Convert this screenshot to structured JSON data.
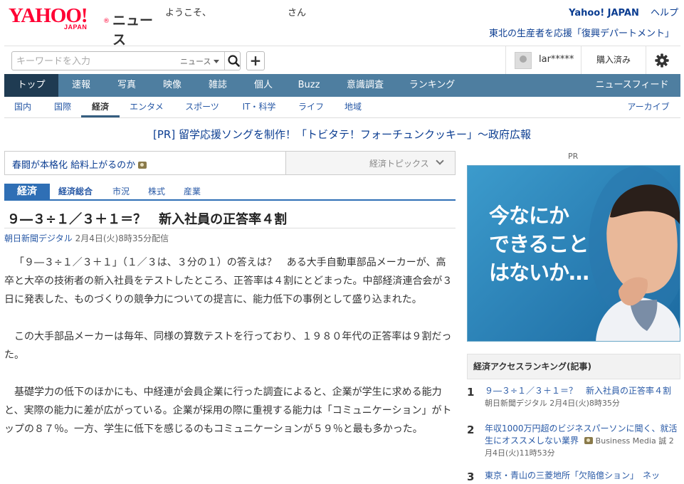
{
  "header": {
    "logo_yahoo": "YAHOO!",
    "logo_japan": "JAPAN",
    "logo_reg": "®",
    "logo_news": "ニュース",
    "welcome": "ようこそ、",
    "welcome_suffix": "さん",
    "yahoo_japan": "Yahoo! JAPAN",
    "help": "ヘルプ",
    "banner_link": "東北の生産者を応援「復興デパートメント」"
  },
  "toolbar": {
    "search_placeholder": "キーワードを入力",
    "search_scope": "ニュース",
    "plus": "+",
    "username": "lar*****",
    "purchased": "購入済み"
  },
  "nav": {
    "items": [
      "トップ",
      "速報",
      "写真",
      "映像",
      "雑誌",
      "個人",
      "Buzz",
      "意識調査",
      "ランキング"
    ],
    "feed": "ニュースフィード"
  },
  "subnav": {
    "items": [
      "国内",
      "国際",
      "経済",
      "エンタメ",
      "スポーツ",
      "IT・科学",
      "ライフ",
      "地域"
    ],
    "archive": "アーカイブ"
  },
  "pr_banner": "[PR] 留学応援ソングを制作！「トビタテ！フォーチュンクッキー」～政府広報",
  "topic": {
    "link": "春闘が本格化 給料上がるのか",
    "label": "経済トピックス"
  },
  "category_tabs": [
    "経済",
    "経済総合",
    "市況",
    "株式",
    "産業"
  ],
  "article": {
    "headline": "９―３÷１／３＋１＝？　新入社員の正答率４割",
    "source": "朝日新聞デジタル",
    "date": " 2月4日(火)8時35分配信",
    "paragraphs": [
      "「９―３÷１／３＋１」（１／３は、３分の１）の答えは？　ある大手自動車部品メーカーが、高卒と大卒の技術者の新入社員をテストしたところ、正答率は４割にとどまった。中部経済連合会が３日に発表した、ものづくりの競争力についての提言に、能力低下の事例として盛り込まれた。",
      "この大手部品メーカーは毎年、同様の算数テストを行っており、１９８０年代の正答率は９割だった。",
      "基礎学力の低下のほかにも、中経連が会員企業に行った調査によると、企業が学生に求める能力と、実際の能力に差が広がっている。企業が採用の際に重視する能力は「コミュニケーション」がトップの８７％。一方、学生に低下を感じるのもコミュニケーションが５９％と最も多かった。"
    ]
  },
  "sidebar": {
    "pr_label": "PR",
    "ad_lines": [
      "今なにか",
      "できること",
      "はないか…"
    ],
    "ranking_title": "経済アクセスランキング(記事)",
    "ranking": [
      {
        "num": "1",
        "title": "９―３÷１／３＋１＝？　新入社員の正答率４割",
        "source": "朝日新聞デジタル",
        "date": "2月4日(火)8時35分"
      },
      {
        "num": "2",
        "title": "年収1000万円超のビジネスパーソンに聞く、就活生にオススメしない業界",
        "source": "Business Media 誠",
        "date": "2月4日(火)11時53分"
      },
      {
        "num": "3",
        "title": "東京・青山の三菱地所「欠陥億ション」　ネッ",
        "source": "",
        "date": ""
      }
    ]
  },
  "colors": {
    "brand_red": "#ff0033",
    "nav_bg": "#4e7ea0",
    "nav_active": "#1f3b52",
    "link_blue": "#2859a6",
    "tab_blue": "#2f6fb5"
  }
}
